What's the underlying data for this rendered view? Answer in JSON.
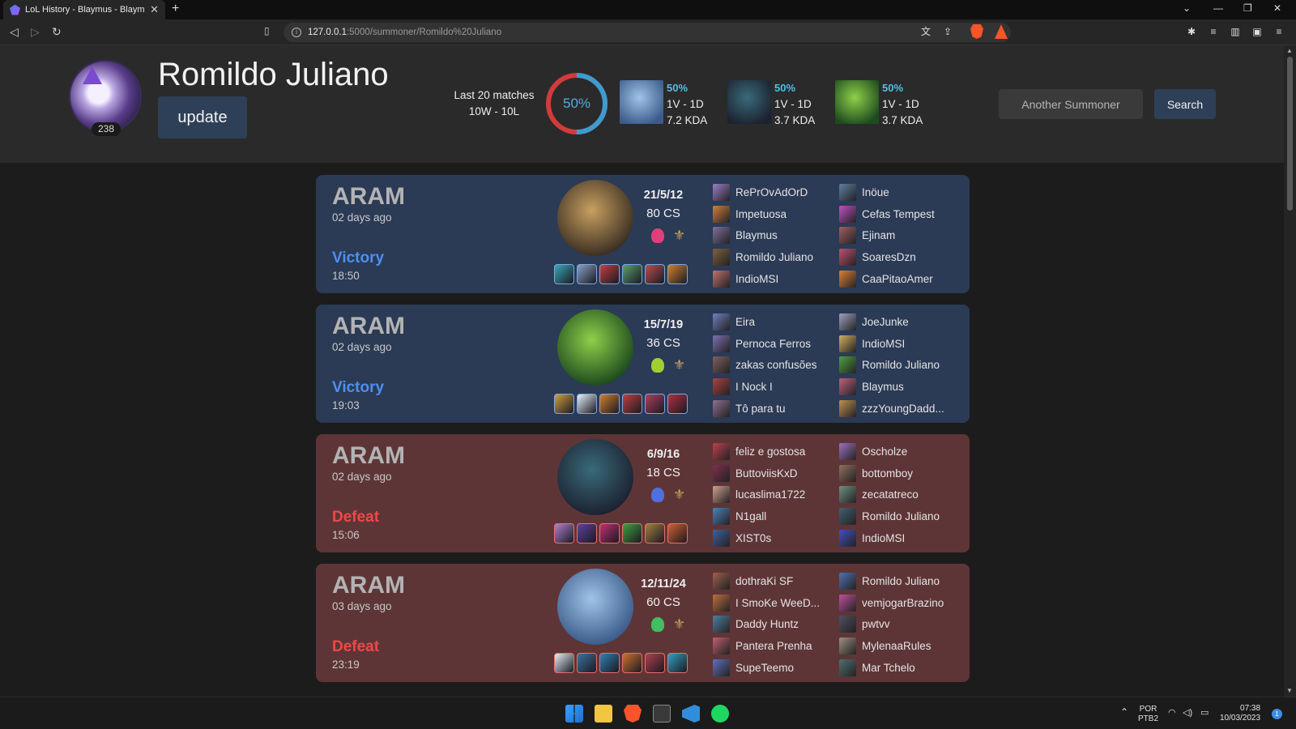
{
  "browser": {
    "tab_title": "LoL History - Blaymus - Blaymus",
    "url_host": "127.0.0.1",
    "url_rest": ":5000/summoner/Romildo%20Juliano"
  },
  "summoner": {
    "name": "Romildo Juliano",
    "level": "238",
    "update_label": "update"
  },
  "stats": {
    "last_label": "Last 20 matches",
    "record": "10W - 10L",
    "winrate": "50%",
    "winrate_value": 0.5,
    "champions": [
      {
        "pct": "50%",
        "record": "1V - 1D",
        "kda": "7.2 KDA",
        "colors": [
          "#9fc4e8",
          "#3b5b8a"
        ]
      },
      {
        "pct": "50%",
        "record": "1V - 1D",
        "kda": "3.7 KDA",
        "colors": [
          "#3a6a7a",
          "#1c2230"
        ]
      },
      {
        "pct": "50%",
        "record": "1V - 1D",
        "kda": "3.7 KDA",
        "colors": [
          "#8ed04a",
          "#1d4a1e"
        ]
      }
    ]
  },
  "search": {
    "placeholder": "Another Summoner",
    "button": "Search"
  },
  "matches": [
    {
      "mode": "ARAM",
      "ago": "02 days ago",
      "result": "Victory",
      "duration": "18:50",
      "kda": "21/5/12",
      "cs": "80 CS",
      "outcome": "win",
      "champ_colors": [
        "#c8a060",
        "#3a2e22"
      ],
      "rune_color": "#e0407a",
      "items": [
        "#3aa8b8",
        "#8aa0c8",
        "#c04040",
        "#5aa070",
        "#b85050",
        "#d08030"
      ],
      "team_a": [
        {
          "name": "RePrOvAdOrD",
          "color": "#9a80c8"
        },
        {
          "name": "Impetuosa",
          "color": "#d08040"
        },
        {
          "name": "Blaymus",
          "color": "#8070a0"
        },
        {
          "name": "Romildo Juliano",
          "color": "#806040"
        },
        {
          "name": "IndioMSI",
          "color": "#c07070"
        }
      ],
      "team_b": [
        {
          "name": "Inöue",
          "color": "#6080a0"
        },
        {
          "name": "Cefas Tempest",
          "color": "#c050c0"
        },
        {
          "name": "Ejinam",
          "color": "#a06060"
        },
        {
          "name": "SoaresDzn",
          "color": "#c05070"
        },
        {
          "name": "CaaPitaoAmer",
          "color": "#e08030"
        }
      ]
    },
    {
      "mode": "ARAM",
      "ago": "02 days ago",
      "result": "Victory",
      "duration": "19:03",
      "kda": "15/7/19",
      "cs": "36 CS",
      "outcome": "win",
      "champ_colors": [
        "#8ed04a",
        "#1d4a1e"
      ],
      "rune_color": "#a0d030",
      "items": [
        "#d0a040",
        "#e8f0f8",
        "#d08030",
        "#c04040",
        "#b04060",
        "#b03040"
      ],
      "team_a": [
        {
          "name": "Eira",
          "color": "#7080c0"
        },
        {
          "name": "Pernoca Ferros",
          "color": "#8070b0"
        },
        {
          "name": "zakas confusões",
          "color": "#806060"
        },
        {
          "name": "I Nock I",
          "color": "#b04040"
        },
        {
          "name": "Tô para tu",
          "color": "#907090"
        }
      ],
      "team_b": [
        {
          "name": "JoeJunke",
          "color": "#a0a0c0"
        },
        {
          "name": "IndioMSI",
          "color": "#d0b060"
        },
        {
          "name": "Romildo Juliano",
          "color": "#50a040"
        },
        {
          "name": "Blaymus",
          "color": "#c06080"
        },
        {
          "name": "zzzYoungDadd...",
          "color": "#c09050"
        }
      ]
    },
    {
      "mode": "ARAM",
      "ago": "02 days ago",
      "result": "Defeat",
      "duration": "15:06",
      "kda": "6/9/16",
      "cs": "18 CS",
      "outcome": "loss",
      "champ_colors": [
        "#3a6a7a",
        "#1c2230"
      ],
      "rune_color": "#5070e0",
      "items": [
        "#b080d0",
        "#6040a0",
        "#c03070",
        "#40a040",
        "#a08040",
        "#d06030"
      ],
      "team_a": [
        {
          "name": "feliz e gostosa",
          "color": "#c04050"
        },
        {
          "name": "ButtoviisKxD",
          "color": "#803050"
        },
        {
          "name": "lucaslima1722",
          "color": "#d0a090"
        },
        {
          "name": "N1gall",
          "color": "#5080c0"
        },
        {
          "name": "XIST0s",
          "color": "#4060a0"
        }
      ],
      "team_b": [
        {
          "name": "Oscholze",
          "color": "#a070c0"
        },
        {
          "name": "bottomboy",
          "color": "#907060"
        },
        {
          "name": "zecatatreco",
          "color": "#709080"
        },
        {
          "name": "Romildo Juliano",
          "color": "#406070"
        },
        {
          "name": "IndioMSI",
          "color": "#4050c0"
        }
      ]
    },
    {
      "mode": "ARAM",
      "ago": "03 days ago",
      "result": "Defeat",
      "duration": "23:19",
      "kda": "12/11/24",
      "cs": "60 CS",
      "outcome": "loss",
      "champ_colors": [
        "#9fc4e8",
        "#3b5b8a"
      ],
      "rune_color": "#40c060",
      "items": [
        "#e8f0f8",
        "#4070a0",
        "#3080b0",
        "#d07030",
        "#b04050",
        "#30a0c0"
      ],
      "team_a": [
        {
          "name": "dothraKi SF",
          "color": "#a06050"
        },
        {
          "name": "I SmoKe WeeD...",
          "color": "#c07040"
        },
        {
          "name": "Daddy Huntz",
          "color": "#5080a0"
        },
        {
          "name": "Pantera Prenha",
          "color": "#c06070"
        },
        {
          "name": "SupeTeemo",
          "color": "#6070c0"
        }
      ],
      "team_b": [
        {
          "name": "Romildo Juliano",
          "color": "#5070b0"
        },
        {
          "name": "vemjogarBrazino",
          "color": "#c050a0"
        },
        {
          "name": "pwtvv",
          "color": "#505060"
        },
        {
          "name": "MylenaaRules",
          "color": "#a09080"
        },
        {
          "name": "Mar Tchelo",
          "color": "#507070"
        }
      ]
    }
  ],
  "taskbar": {
    "lang1": "POR",
    "lang2": "PTB2",
    "time": "07:38",
    "date": "10/03/2023",
    "notifications": "1"
  }
}
